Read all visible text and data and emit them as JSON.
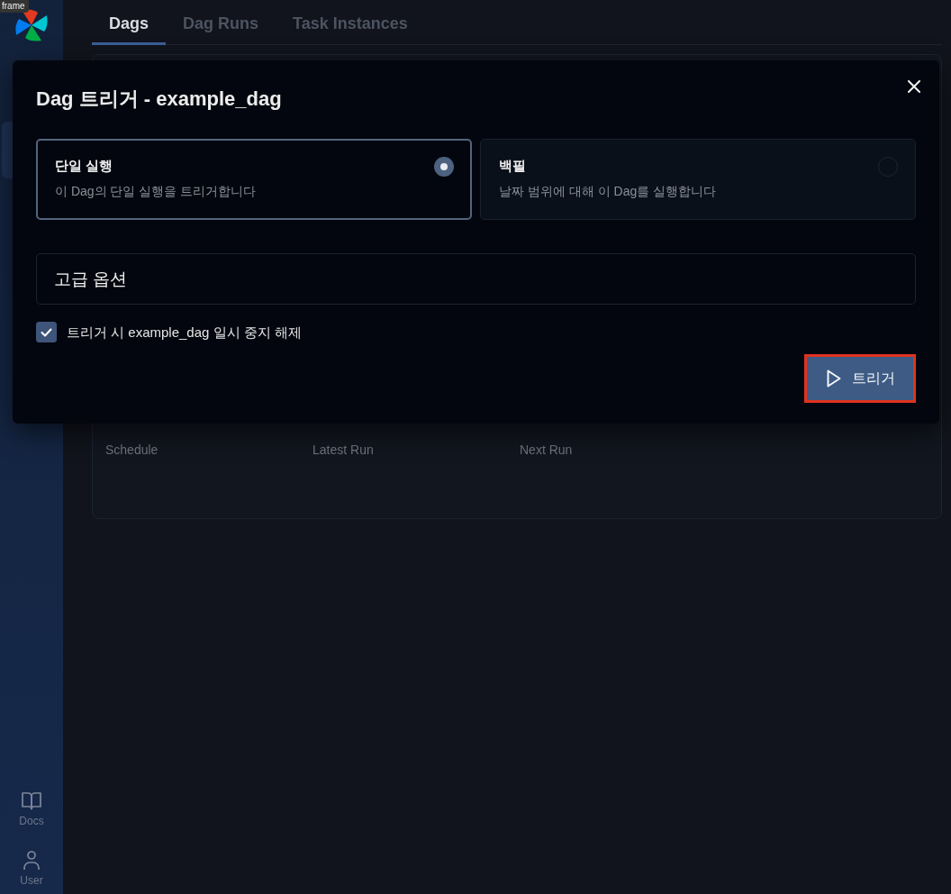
{
  "frame_tag": {
    "text": "frame"
  },
  "sidebar": {
    "items": [
      {
        "kind": "docs",
        "label": "Docs"
      },
      {
        "kind": "user",
        "label": "User"
      }
    ]
  },
  "tabs": [
    {
      "label": "Dags",
      "selected": true
    },
    {
      "label": "Dag Runs",
      "selected": false
    },
    {
      "label": "Task Instances",
      "selected": false
    }
  ],
  "dag_card": {
    "columns": [
      "Schedule",
      "Latest Run",
      "Next Run"
    ]
  },
  "dialog": {
    "title": "Dag 트리거 - example_dag",
    "run_options": [
      {
        "title": "단일 실행",
        "description": "이 Dag의 단일 실행을 트리거합니다",
        "selected": true
      },
      {
        "title": "백필",
        "description": "날짜 범위에 대해 이 Dag를 실행합니다",
        "selected": false
      }
    ],
    "advanced_options": {
      "label": "고급 옵션"
    },
    "unpause_checkbox": {
      "label": "트리거 시 example_dag 일시 중지 해제",
      "checked": true
    },
    "trigger_button": {
      "label": "트리거"
    }
  }
}
